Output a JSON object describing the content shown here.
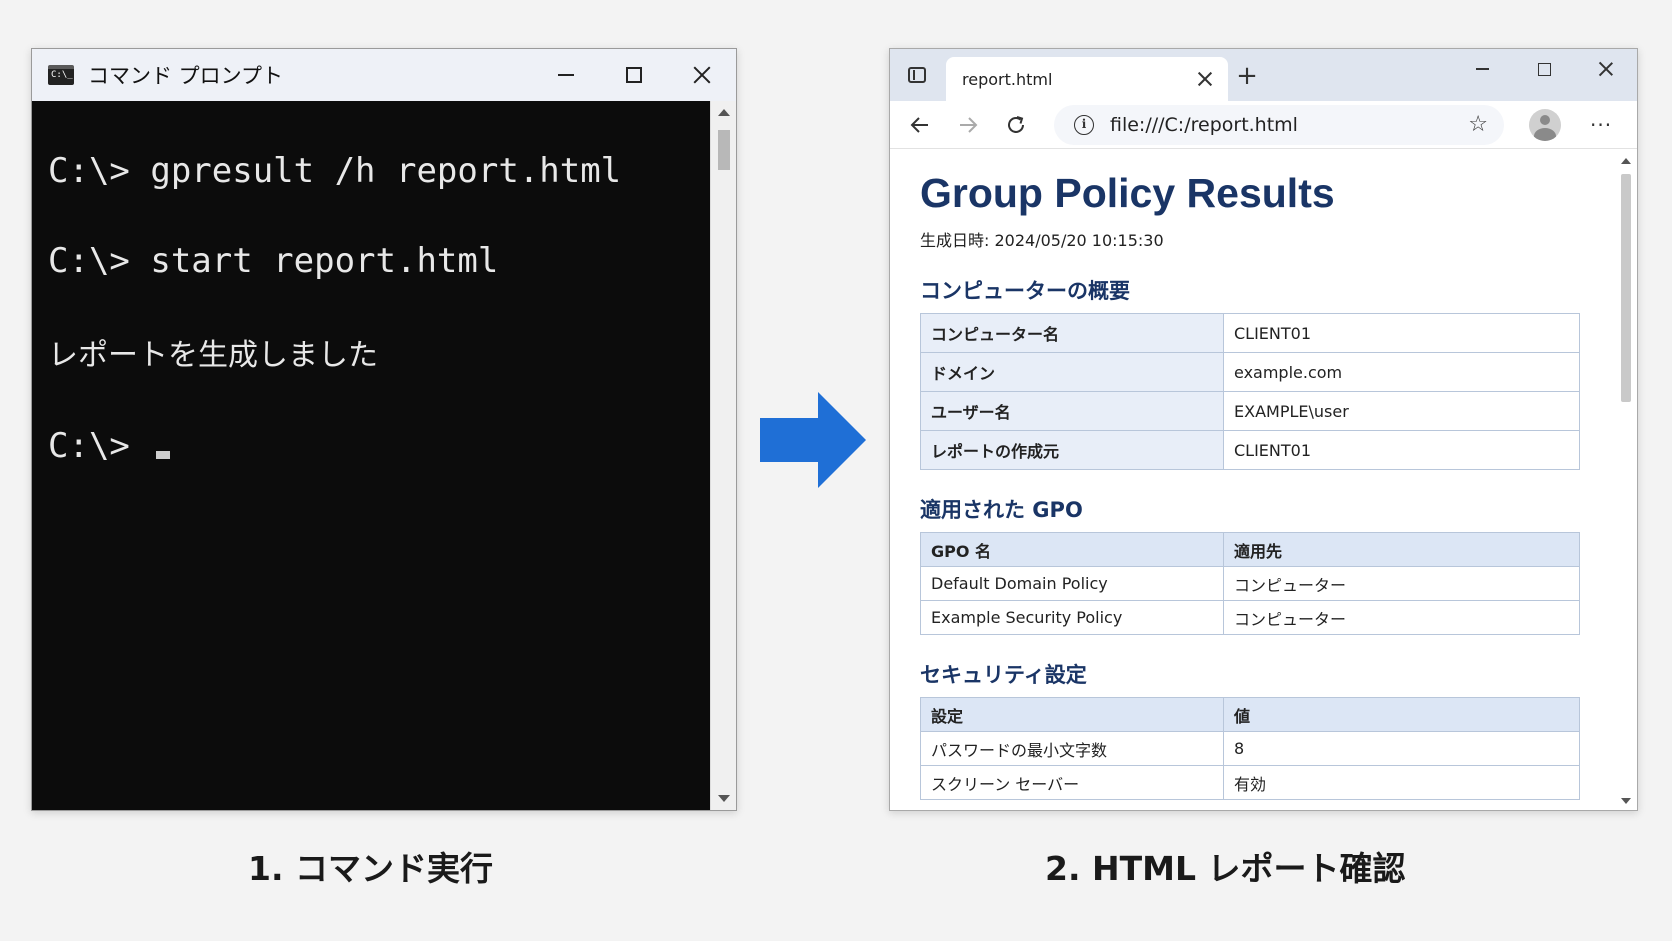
{
  "cmd": {
    "title": "コマンド プロンプト",
    "icon_text": "C:\\_",
    "lines": [
      "C:\\> gpresult /h report.html",
      "C:\\> start report.html",
      "レポートを生成しました",
      "C:\\> "
    ]
  },
  "browser": {
    "tab_title": "report.html",
    "new_tab": "+",
    "address": "file:///C:/report.html",
    "menu": "···"
  },
  "report": {
    "title": "Group Policy Results",
    "generated": "生成日時: 2024/05/20 10:15:30",
    "summary": {
      "heading": "コンピューターの概要",
      "rows": [
        {
          "key": "コンピューター名",
          "value": "CLIENT01"
        },
        {
          "key": "ドメイン",
          "value": "example.com"
        },
        {
          "key": "ユーザー名",
          "value": "EXAMPLE\\user"
        },
        {
          "key": "レポートの作成元",
          "value": "CLIENT01"
        }
      ]
    },
    "gpo": {
      "heading": "適用された GPO",
      "columns": [
        "GPO 名",
        "適用先"
      ],
      "rows": [
        [
          "Default Domain Policy",
          "コンピューター"
        ],
        [
          "Example Security Policy",
          "コンピューター"
        ]
      ]
    },
    "security": {
      "heading": "セキュリティ設定",
      "columns": [
        "設定",
        "値"
      ],
      "rows": [
        [
          "パスワードの最小文字数",
          "8"
        ],
        [
          "スクリーン セーバー",
          "有効"
        ]
      ]
    }
  },
  "captions": {
    "step1": "1. コマンド実行",
    "step2": "2. HTML レポート確認"
  },
  "colors": {
    "arrow": "#1f6fd6",
    "heading": "#1a3566"
  }
}
